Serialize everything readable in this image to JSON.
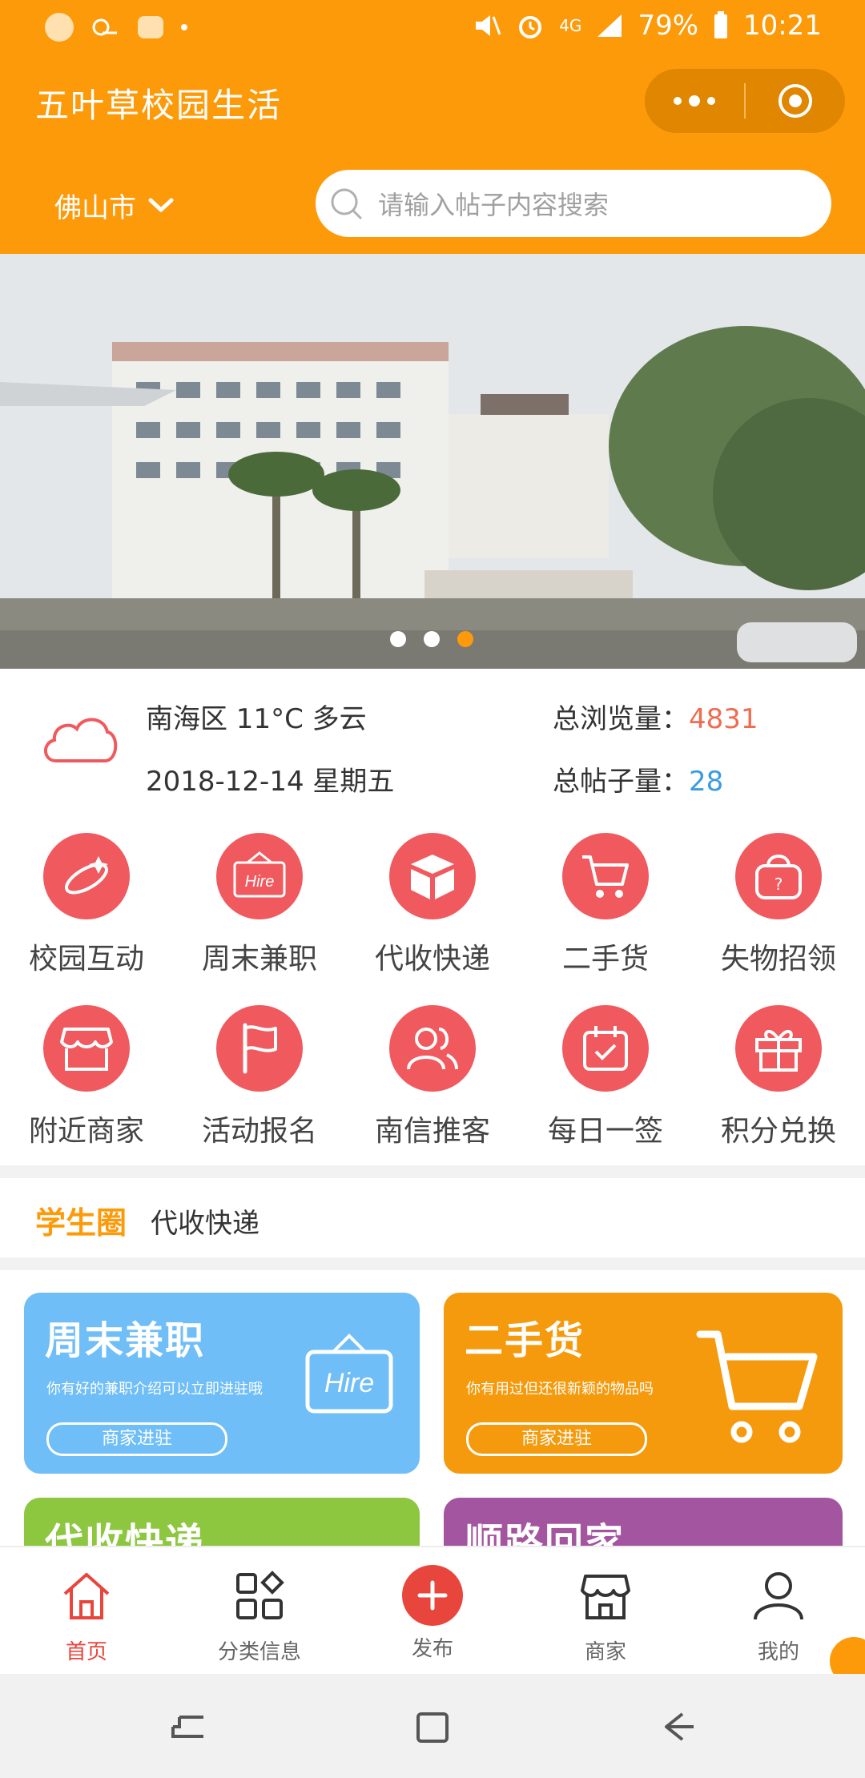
{
  "status_bar": {
    "battery": "79%",
    "time": "10:21",
    "network": "4G"
  },
  "header": {
    "title": "五叶草校园生活"
  },
  "location": {
    "city": "佛山市"
  },
  "search": {
    "placeholder": "请输入帖子内容搜索"
  },
  "banner": {
    "slide_count": 3,
    "active_slide": 3
  },
  "weather": {
    "summary": "南海区 11°C 多云",
    "date": "2018-12-14 星期五"
  },
  "stats": {
    "views_label": "总浏览量：",
    "views_value": "4831",
    "posts_label": "总帖子量：",
    "posts_value": "28"
  },
  "grid": {
    "row1": [
      {
        "label": "校园互动",
        "icon": "satellite-icon"
      },
      {
        "label": "周末兼职",
        "icon": "hire-sign-icon"
      },
      {
        "label": "代收快递",
        "icon": "package-icon"
      },
      {
        "label": "二手货",
        "icon": "cart-icon"
      },
      {
        "label": "失物招领",
        "icon": "lost-bag-icon"
      }
    ],
    "row2": [
      {
        "label": "附近商家",
        "icon": "shop-icon"
      },
      {
        "label": "活动报名",
        "icon": "flag-icon"
      },
      {
        "label": "南信推客",
        "icon": "users-icon"
      },
      {
        "label": "每日一签",
        "icon": "calendar-check-icon"
      },
      {
        "label": "积分兑换",
        "icon": "gift-icon"
      }
    ]
  },
  "student_circle": {
    "title": "学生圈",
    "latest": "代收快递"
  },
  "cards": [
    {
      "title": "周末兼职",
      "subtitle": "你有好的兼职介绍可以立即进驻哦",
      "button": "商家进驻",
      "color": "#6fbef7",
      "icon": "hire-sign-icon"
    },
    {
      "title": "二手货",
      "subtitle": "你有用过但还很新颖的物品吗",
      "button": "商家进驻",
      "color": "#f59a0c",
      "icon": "cart-icon"
    },
    {
      "title": "代收快递",
      "color": "#8dc63f"
    },
    {
      "title": "顺路回家",
      "color": "#a455a0"
    }
  ],
  "tabbar": [
    {
      "label": "首页",
      "icon": "home-icon",
      "active": true
    },
    {
      "label": "分类信息",
      "icon": "category-icon"
    },
    {
      "label": "发布",
      "icon": "publish-plus-icon"
    },
    {
      "label": "商家",
      "icon": "store-icon"
    },
    {
      "label": "我的",
      "icon": "profile-icon"
    }
  ],
  "colors": {
    "primary": "#fd9a0a",
    "icon_red": "#f05a5e",
    "active_tab": "#e8453c"
  }
}
